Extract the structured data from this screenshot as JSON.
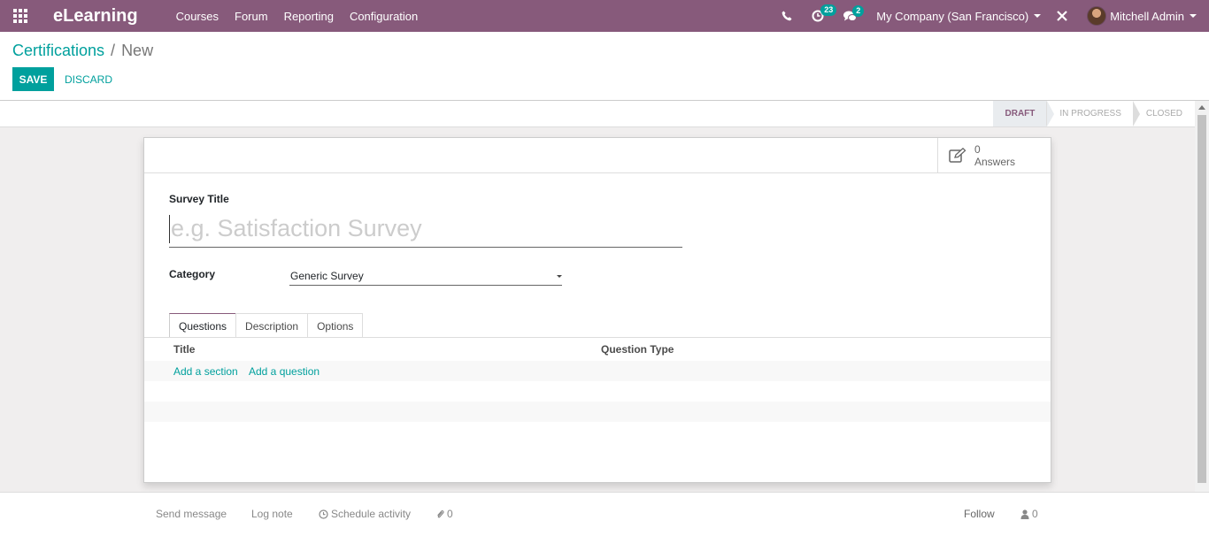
{
  "navbar": {
    "brand": "eLearning",
    "menu": [
      "Courses",
      "Forum",
      "Reporting",
      "Configuration"
    ],
    "activity_count": "23",
    "message_count": "2",
    "company": "My Company (San Francisco)",
    "user": "Mitchell Admin"
  },
  "breadcrumb": {
    "parent": "Certifications",
    "separator": "/",
    "current": "New"
  },
  "actions": {
    "save_label": "SAVE",
    "discard_label": "DISCARD"
  },
  "stages": [
    {
      "label": "DRAFT",
      "active": true
    },
    {
      "label": "IN PROGRESS",
      "active": false
    },
    {
      "label": "CLOSED",
      "active": false
    }
  ],
  "stat_button": {
    "count": "0",
    "label": "Answers"
  },
  "form": {
    "title_label": "Survey Title",
    "title_placeholder": "e.g. Satisfaction Survey",
    "category_label": "Category",
    "category_value": "Generic Survey"
  },
  "tabs": [
    "Questions",
    "Description",
    "Options"
  ],
  "questions_list": {
    "col_title": "Title",
    "col_type": "Question Type",
    "add_section": "Add a section",
    "add_question": "Add a question"
  },
  "chatter": {
    "send_message": "Send message",
    "log_note": "Log note",
    "schedule_activity": "Schedule activity",
    "attachments": "0",
    "follow": "Follow",
    "followers": "0"
  },
  "colors": {
    "navbar": "#875a7b",
    "accent": "#00a09d"
  }
}
